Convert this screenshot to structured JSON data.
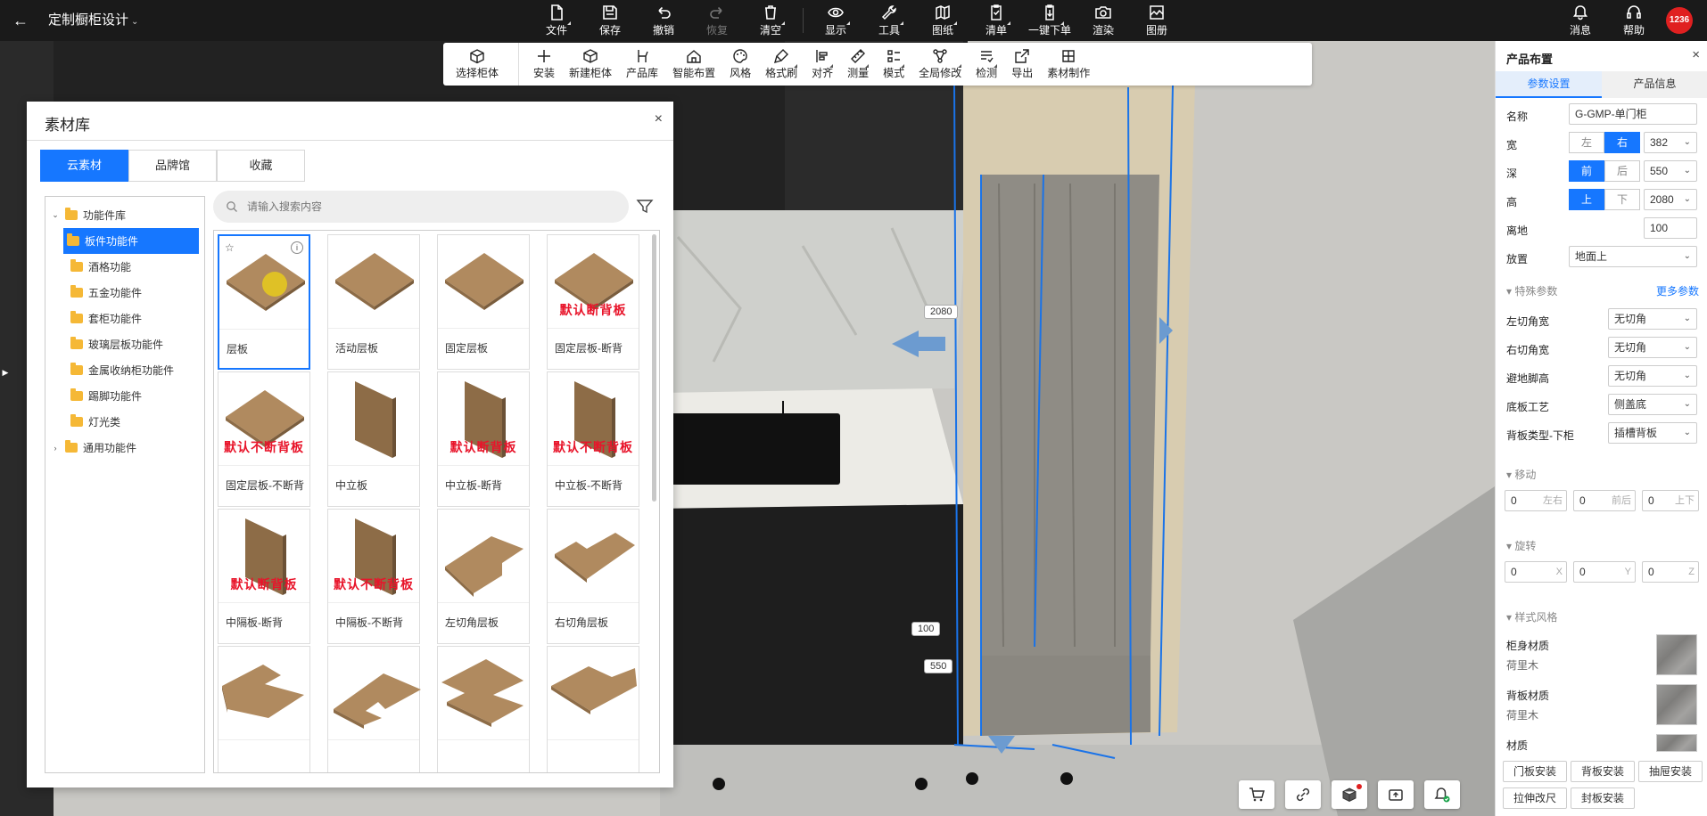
{
  "topbar": {
    "back": "←",
    "title": "定制橱柜设计",
    "tools": [
      {
        "label": "文件",
        "icon": "file-icon",
        "corner": true,
        "disabled": false
      },
      {
        "label": "保存",
        "icon": "save-icon",
        "corner": false,
        "disabled": false
      },
      {
        "label": "撤销",
        "icon": "undo-icon",
        "corner": false,
        "disabled": false
      },
      {
        "label": "恢复",
        "icon": "redo-icon",
        "corner": false,
        "disabled": true
      },
      {
        "label": "清空",
        "icon": "trash-icon",
        "corner": true,
        "disabled": false
      },
      {
        "label": "显示",
        "icon": "eye-icon",
        "corner": true,
        "disabled": false
      },
      {
        "label": "工具",
        "icon": "wrench-icon",
        "corner": true,
        "disabled": false
      },
      {
        "label": "图纸",
        "icon": "map-icon",
        "corner": true,
        "disabled": false
      },
      {
        "label": "清单",
        "icon": "checklist-icon",
        "corner": true,
        "disabled": false
      },
      {
        "label": "一键下单",
        "icon": "order-icon",
        "corner": true,
        "disabled": false
      },
      {
        "label": "渲染",
        "icon": "camera-icon",
        "corner": false,
        "disabled": false
      },
      {
        "label": "图册",
        "icon": "album-icon",
        "corner": false,
        "disabled": false
      }
    ],
    "right": [
      {
        "label": "消息",
        "icon": "bell-icon"
      },
      {
        "label": "帮助",
        "icon": "headset-icon"
      }
    ],
    "avatar": "1236"
  },
  "subtoolbar": {
    "first": {
      "label": "选择柜体",
      "icon": "cabinet-icon"
    },
    "tools": [
      {
        "label": "安装",
        "icon": "plus-icon",
        "corner": false
      },
      {
        "label": "新建柜体",
        "icon": "cube-icon",
        "corner": false
      },
      {
        "label": "产品库",
        "icon": "chair-icon",
        "corner": false
      },
      {
        "label": "智能布置",
        "icon": "house-icon",
        "corner": false
      },
      {
        "label": "风格",
        "icon": "palette-icon",
        "corner": false
      },
      {
        "label": "格式刷",
        "icon": "brush-icon",
        "corner": true
      },
      {
        "label": "对齐",
        "icon": "align-icon",
        "corner": true
      },
      {
        "label": "测量",
        "icon": "ruler-icon",
        "corner": true
      },
      {
        "label": "模式",
        "icon": "list-icon",
        "corner": true
      },
      {
        "label": "全局修改",
        "icon": "nodes-icon",
        "corner": true
      },
      {
        "label": "检测",
        "icon": "check-list-icon",
        "corner": true
      },
      {
        "label": "导出",
        "icon": "export-icon",
        "corner": false
      },
      {
        "label": "素材制作",
        "icon": "grid-plus-icon",
        "corner": false
      }
    ]
  },
  "viewport": {
    "dim_height": "2080",
    "dim_ground": "100",
    "dim_depth": "550"
  },
  "library": {
    "title": "素材库",
    "close": "×",
    "tabs": [
      "云素材",
      "品牌馆",
      "收藏"
    ],
    "active_tab": 0,
    "search_placeholder": "请输入搜索内容",
    "tree": [
      {
        "label": "功能件库",
        "level": 0,
        "caret": "down",
        "selected": false
      },
      {
        "label": "板件功能件",
        "level": 1,
        "caret": "",
        "selected": true
      },
      {
        "label": "酒格功能",
        "level": 1,
        "caret": "",
        "selected": false
      },
      {
        "label": "五金功能件",
        "level": 1,
        "caret": "",
        "selected": false
      },
      {
        "label": "套柜功能件",
        "level": 1,
        "caret": "",
        "selected": false
      },
      {
        "label": "玻璃层板功能件",
        "level": 1,
        "caret": "",
        "selected": false
      },
      {
        "label": "金属收纳柜功能件",
        "level": 1,
        "caret": "",
        "selected": false
      },
      {
        "label": "踢脚功能件",
        "level": 1,
        "caret": "",
        "selected": false
      },
      {
        "label": "灯光类",
        "level": 1,
        "caret": "",
        "selected": false
      },
      {
        "label": "通用功能件",
        "level": 0,
        "caret": "right",
        "selected": false
      }
    ],
    "items": [
      {
        "name": "层板",
        "shape": "flat",
        "tag": "",
        "selected": true
      },
      {
        "name": "活动层板",
        "shape": "flat",
        "tag": "",
        "selected": false
      },
      {
        "name": "固定层板",
        "shape": "flat",
        "tag": "",
        "selected": false
      },
      {
        "name": "固定层板-断背",
        "shape": "flat",
        "tag": "默认断背板",
        "selected": false
      },
      {
        "name": "固定层板-不断背",
        "shape": "flat",
        "tag": "默认不断背板",
        "selected": false
      },
      {
        "name": "中立板",
        "shape": "vertical",
        "tag": "",
        "selected": false
      },
      {
        "name": "中立板-断背",
        "shape": "vertical",
        "tag": "默认断背板",
        "selected": false
      },
      {
        "name": "中立板-不断背",
        "shape": "vertical",
        "tag": "默认不断背板",
        "selected": false
      },
      {
        "name": "中隔板-断背",
        "shape": "vertical",
        "tag": "默认断背板",
        "selected": false
      },
      {
        "name": "中隔板-不断背",
        "shape": "vertical",
        "tag": "默认不断背板",
        "selected": false
      },
      {
        "name": "左切角层板",
        "shape": "lcut",
        "tag": "",
        "selected": false
      },
      {
        "name": "右切角层板",
        "shape": "rcut",
        "tag": "",
        "selected": false
      },
      {
        "name": "",
        "shape": "lshape",
        "tag": "",
        "selected": false
      },
      {
        "name": "",
        "shape": "notch",
        "tag": "",
        "selected": false
      },
      {
        "name": "",
        "shape": "tshape",
        "tag": "",
        "selected": false
      },
      {
        "name": "",
        "shape": "lshape2",
        "tag": "",
        "selected": false
      }
    ]
  },
  "panel": {
    "title": "产品布置",
    "close": "×",
    "tabs": [
      "参数设置",
      "产品信息"
    ],
    "name_label": "名称",
    "name_value": "G-GMP-单门柜",
    "width_label": "宽",
    "width_seg": [
      "左",
      "右"
    ],
    "width_on": 1,
    "width_value": "382",
    "depth_label": "深",
    "depth_seg": [
      "前",
      "后"
    ],
    "depth_on": 0,
    "depth_value": "550",
    "height_label": "高",
    "height_seg": [
      "上",
      "下"
    ],
    "height_on": 0,
    "height_value": "2080",
    "ground_label": "离地",
    "ground_value": "100",
    "place_label": "放置",
    "place_value": "地面上",
    "special_section": "特殊参数",
    "more_link": "更多参数",
    "special_rows": [
      {
        "label": "左切角宽",
        "value": "无切角"
      },
      {
        "label": "右切角宽",
        "value": "无切角"
      },
      {
        "label": "避地脚高",
        "value": "无切角"
      },
      {
        "label": "底板工艺",
        "value": "侧盖底"
      },
      {
        "label": "背板类型-下柜",
        "value": "插槽背板"
      }
    ],
    "move_section": "移动",
    "move_fields": [
      {
        "value": "0",
        "axis": "左右"
      },
      {
        "value": "0",
        "axis": "前后"
      },
      {
        "value": "0",
        "axis": "上下"
      }
    ],
    "rotate_section": "旋转",
    "rotate_fields": [
      {
        "value": "0",
        "axis": "X"
      },
      {
        "value": "0",
        "axis": "Y"
      },
      {
        "value": "0",
        "axis": "Z"
      }
    ],
    "style_section": "样式风格",
    "materials": [
      {
        "label": "柜身材质",
        "value": "荷里木"
      },
      {
        "label": "背板材质",
        "value": "荷里木"
      },
      {
        "label": "材质",
        "value": ""
      }
    ],
    "footer_buttons": [
      "门板安装",
      "背板安装",
      "抽屉安装",
      "拉伸改尺",
      "封板安装"
    ]
  },
  "viewport_tools": [
    {
      "icon": "cart-icon"
    },
    {
      "icon": "link-icon"
    },
    {
      "icon": "box-icon",
      "dot": true
    },
    {
      "icon": "screenshot-icon"
    },
    {
      "icon": "bell-check-icon"
    }
  ]
}
